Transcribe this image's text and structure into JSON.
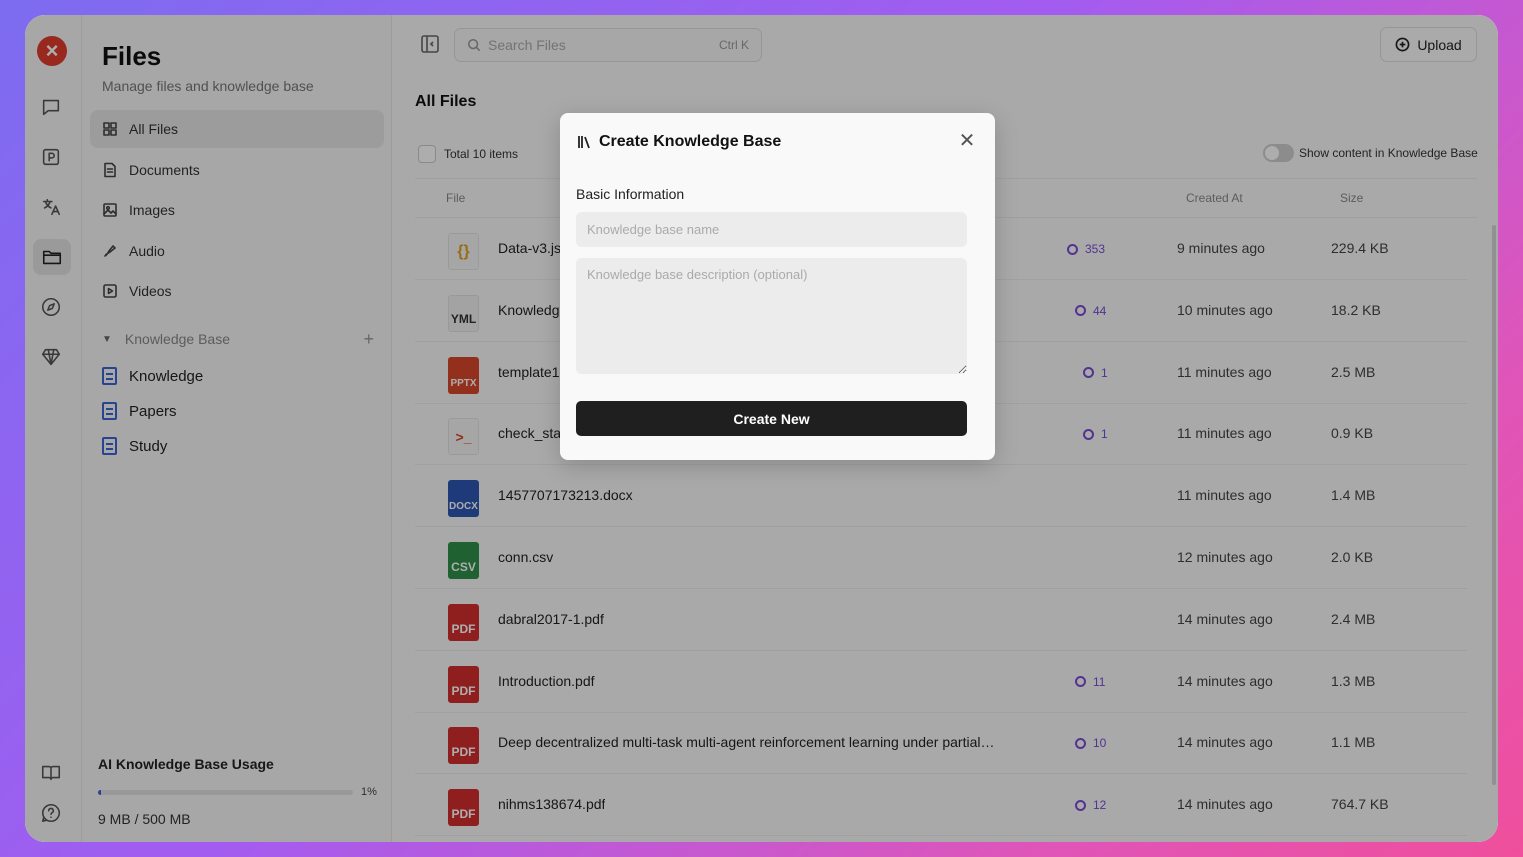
{
  "sidebar": {
    "title": "Files",
    "subtitle": "Manage files and knowledge base",
    "nav": [
      {
        "label": "All Files",
        "icon": "grid-icon"
      },
      {
        "label": "Documents",
        "icon": "document-icon"
      },
      {
        "label": "Images",
        "icon": "image-icon"
      },
      {
        "label": "Audio",
        "icon": "audio-icon"
      },
      {
        "label": "Videos",
        "icon": "video-icon"
      }
    ],
    "knowledge_base_header": "Knowledge Base",
    "knowledge_bases": [
      "Knowledge",
      "Papers",
      "Study"
    ],
    "usage": {
      "title": "AI Knowledge Base Usage",
      "percent": 1,
      "percent_label": "1%",
      "size_label": "9 MB / 500 MB"
    }
  },
  "toolbar": {
    "search_placeholder": "Search Files",
    "search_shortcut": "Ctrl K",
    "upload_label": "Upload"
  },
  "main": {
    "title": "All Files",
    "total_label": "Total 10 items",
    "toggle_label": "Show content in Knowledge Base",
    "columns": {
      "file": "File",
      "created": "Created At",
      "size": "Size"
    },
    "rows": [
      {
        "name": "Data-v3.js",
        "type": "json",
        "badge": "{}",
        "chunks": "353",
        "created": "9 minutes ago",
        "size": "229.4 KB"
      },
      {
        "name": "Knowledg",
        "type": "yml",
        "badge": "YML",
        "chunks": "44",
        "created": "10 minutes ago",
        "size": "18.2 KB"
      },
      {
        "name": "template1",
        "type": "pptx",
        "badge": "PPTX",
        "chunks": "1",
        "created": "11 minutes ago",
        "size": "2.5 MB"
      },
      {
        "name": "check_sta",
        "type": "sh",
        "badge": ">_",
        "chunks": "1",
        "created": "11 minutes ago",
        "size": "0.9 KB"
      },
      {
        "name": "1457707173213.docx",
        "type": "docx",
        "badge": "DOCX",
        "chunks": "",
        "created": "11 minutes ago",
        "size": "1.4 MB"
      },
      {
        "name": "conn.csv",
        "type": "csv",
        "badge": "CSV",
        "chunks": "",
        "created": "12 minutes ago",
        "size": "2.0 KB"
      },
      {
        "name": "dabral2017-1.pdf",
        "type": "pdf",
        "badge": "PDF",
        "chunks": "",
        "created": "14 minutes ago",
        "size": "2.4 MB"
      },
      {
        "name": "Introduction.pdf",
        "type": "pdf",
        "badge": "PDF",
        "chunks": "11",
        "created": "14 minutes ago",
        "size": "1.3 MB"
      },
      {
        "name": "Deep decentralized multi-task multi-agent reinforcement learning under partial…",
        "type": "pdf",
        "badge": "PDF",
        "chunks": "10",
        "created": "14 minutes ago",
        "size": "1.1 MB"
      },
      {
        "name": "nihms138674.pdf",
        "type": "pdf",
        "badge": "PDF",
        "chunks": "12",
        "created": "14 minutes ago",
        "size": "764.7 KB"
      }
    ]
  },
  "modal": {
    "title": "Create Knowledge Base",
    "section_label": "Basic Information",
    "name_placeholder": "Knowledge base name",
    "description_placeholder": "Knowledge base description (optional)",
    "submit_label": "Create New"
  },
  "colors": {
    "accent": "#3a63d8",
    "chunk": "#7b4ad8",
    "logo": "#e23b2f"
  }
}
